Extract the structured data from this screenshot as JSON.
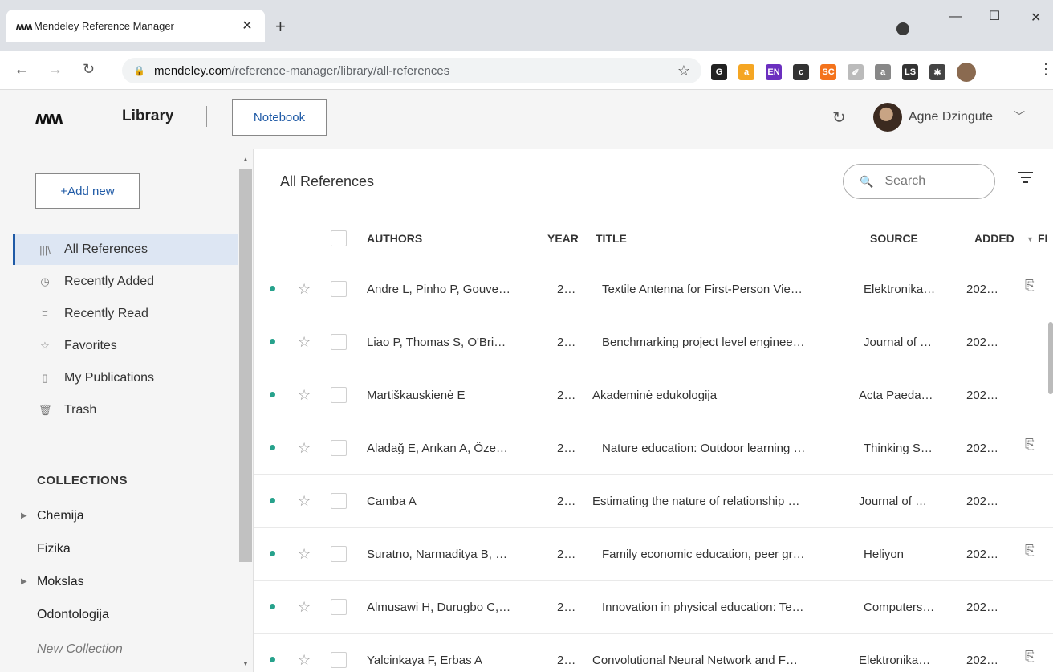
{
  "browser": {
    "tab_logo": "ʍʍ",
    "tab_title": "Mendeley Reference Manager",
    "tab_close": "✕",
    "new_tab": "+",
    "url_host": "mendeley.com",
    "url_path": "/reference-manager/library/all-references",
    "extensions": [
      {
        "label": "G",
        "color": "#222222"
      },
      {
        "label": "a",
        "color": "#f5a623"
      },
      {
        "label": "EN",
        "color": "#6b2fbf"
      },
      {
        "label": "c",
        "color": "#333333"
      },
      {
        "label": "SC",
        "color": "#f4731c"
      },
      {
        "label": "✐",
        "color": "#bbbbbb"
      },
      {
        "label": "a",
        "color": "#888888"
      },
      {
        "label": "LS",
        "color": "#333333"
      },
      {
        "label": "✱",
        "color": "#444444"
      }
    ]
  },
  "header": {
    "logo": "ʍʍ",
    "library_title": "Library",
    "notebook_label": "Notebook",
    "user_name": "Agne Dzingute"
  },
  "sidebar": {
    "add_new_label": "+Add new",
    "items": [
      {
        "label": "All References",
        "icon": "library-icon",
        "glyph": "|||\\",
        "active": true
      },
      {
        "label": "Recently Added",
        "icon": "clock-icon",
        "glyph": "◷",
        "active": false
      },
      {
        "label": "Recently Read",
        "icon": "bookmark-icon",
        "glyph": "⌑",
        "active": false
      },
      {
        "label": "Favorites",
        "icon": "star-icon",
        "glyph": "☆",
        "active": false
      },
      {
        "label": "My Publications",
        "icon": "publications-icon",
        "glyph": "▯",
        "active": false
      },
      {
        "label": "Trash",
        "icon": "trash-icon",
        "glyph": "🗑",
        "active": false
      }
    ],
    "collections_heading": "COLLECTIONS",
    "collections": [
      {
        "label": "Chemija",
        "expandable": true
      },
      {
        "label": "Fizika",
        "expandable": false
      },
      {
        "label": "Mokslas",
        "expandable": true
      },
      {
        "label": "Odontologija",
        "expandable": false
      }
    ],
    "new_collection": "New Collection"
  },
  "main": {
    "title": "All References",
    "search_placeholder": "Search",
    "columns": {
      "authors": "AUTHORS",
      "year": "YEAR",
      "title": "TITLE",
      "source": "SOURCE",
      "added": "ADDED",
      "sort_arrow": "▼",
      "file": "FI"
    },
    "rows": [
      {
        "authors": "Andre L, Pinho P, Gouve…",
        "year": "2…",
        "title": "Textile Antenna for First-Person Vie…",
        "source": "Elektronika…",
        "added": "202…",
        "has_pdf": true,
        "title_indent": true
      },
      {
        "authors": "Liao P, Thomas S, O'Bri…",
        "year": "2…",
        "title": "Benchmarking project level enginee…",
        "source": "Journal of …",
        "added": "202…",
        "has_pdf": false,
        "title_indent": true
      },
      {
        "authors": "Martiškauskienė E",
        "year": "2…",
        "title": "Akademinė edukologija",
        "source": "Acta Paeda…",
        "added": "202…",
        "has_pdf": false,
        "title_indent": false
      },
      {
        "authors": "Aladağ E, Arıkan A, Öze…",
        "year": "2…",
        "title": "Nature education: Outdoor learning …",
        "source": "Thinking S…",
        "added": "202…",
        "has_pdf": true,
        "title_indent": true
      },
      {
        "authors": "Camba A",
        "year": "2…",
        "title": "Estimating the nature of relationship …",
        "source": "Journal of …",
        "added": "202…",
        "has_pdf": false,
        "title_indent": false
      },
      {
        "authors": "Suratno, Narmaditya B, …",
        "year": "2…",
        "title": "Family economic education, peer gr…",
        "source": "Heliyon",
        "added": "202…",
        "has_pdf": true,
        "title_indent": true
      },
      {
        "authors": "Almusawi H, Durugbo C,…",
        "year": "2…",
        "title": "Innovation in physical education: Te…",
        "source": "Computers…",
        "added": "202…",
        "has_pdf": false,
        "title_indent": true
      },
      {
        "authors": "Yalcinkaya F, Erbas A",
        "year": "2…",
        "title": "Convolutional Neural Network and F…",
        "source": "Elektronika…",
        "added": "202…",
        "has_pdf": true,
        "title_indent": false
      }
    ]
  },
  "colors": {
    "accent": "#1f5aa6",
    "unread_dot": "#27a28c",
    "active_bg": "#dde6f3"
  }
}
